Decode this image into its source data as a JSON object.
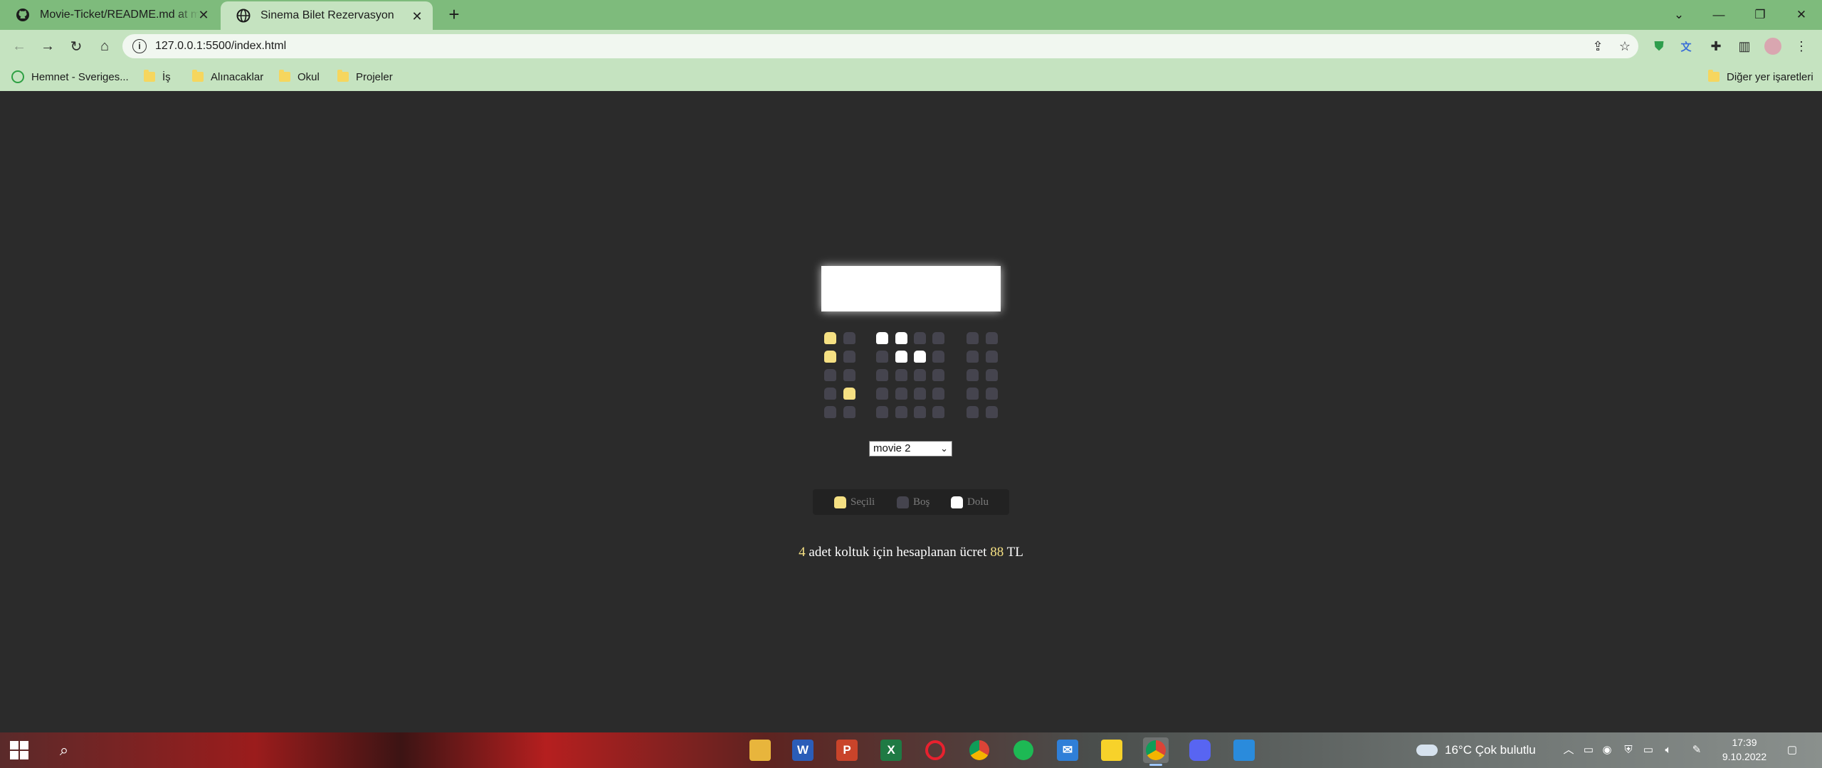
{
  "browser": {
    "tabs": [
      {
        "title": "Movie-Ticket/README.md at ma",
        "favicon": "github-icon",
        "active": false
      },
      {
        "title": "Sinema Bilet Rezervasyon",
        "favicon": "globe-icon",
        "active": true
      }
    ],
    "url": "127.0.0.1:5500/index.html",
    "bookmarks": [
      {
        "label": "Hemnet - Sveriges...",
        "icon": "hemnet-icon"
      },
      {
        "label": "İş",
        "icon": "folder-icon"
      },
      {
        "label": "Alınacaklar",
        "icon": "folder-icon"
      },
      {
        "label": "Okul",
        "icon": "folder-icon"
      },
      {
        "label": "Projeler",
        "icon": "folder-icon"
      }
    ],
    "other_bookmarks": "Diğer yer işaretleri",
    "colors": {
      "tabstrip": "#7ebb7c",
      "toolbar": "#c5e3c0"
    }
  },
  "page": {
    "seat_rows": [
      [
        "selected",
        "empty",
        "empty",
        "empty",
        "occupied",
        "occupied",
        "empty",
        "empty",
        "empty",
        "empty"
      ],
      [
        "selected",
        "empty",
        "empty",
        "empty",
        "empty",
        "occupied",
        "occupied",
        "empty",
        "empty",
        "empty"
      ],
      [
        "empty",
        "empty",
        "empty",
        "empty",
        "empty",
        "empty",
        "empty",
        "empty",
        "empty",
        "empty"
      ],
      [
        "empty",
        "selected",
        "empty",
        "selected",
        "empty",
        "empty",
        "empty",
        "empty",
        "empty",
        "empty"
      ],
      [
        "empty",
        "empty",
        "empty",
        "empty",
        "empty",
        "empty",
        "empty",
        "empty",
        "empty",
        "empty"
      ]
    ],
    "movie_select": {
      "value": "movie 2"
    },
    "legend": [
      {
        "label": "Seçili",
        "state": "selected"
      },
      {
        "label": "Boş",
        "state": "empty"
      },
      {
        "label": "Dolu",
        "state": "occupied"
      }
    ],
    "summary": {
      "count": "4",
      "middle": " adet koltuk için hesaplanan ücret ",
      "price": "88",
      "currency": " TL"
    },
    "colors": {
      "background": "#2b2b2b",
      "selected": "#f5e083",
      "empty": "#45444e",
      "occupied": "#ffffff"
    }
  },
  "taskbar": {
    "apps": [
      "file-explorer-icon",
      "word-icon",
      "powerpoint-icon",
      "excel-icon",
      "opera-icon",
      "chrome-icon",
      "spotify-icon",
      "mail-icon",
      "sticky-notes-icon",
      "chrome-active-icon",
      "discord-icon",
      "vscode-icon"
    ],
    "weather": "16°C  Çok bulutlu",
    "time": "17:39",
    "date": "9.10.2022"
  }
}
